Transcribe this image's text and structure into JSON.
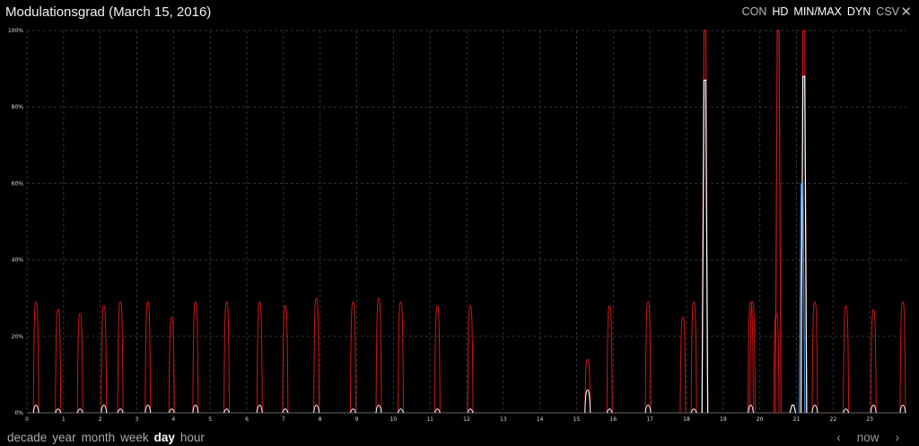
{
  "header": {
    "title": "Modulationsgrad (March 15, 2016)",
    "options": [
      {
        "label": "CON",
        "active": false
      },
      {
        "label": "HD",
        "active": true
      },
      {
        "label": "MIN/MAX",
        "active": true
      },
      {
        "label": "DYN",
        "active": true
      },
      {
        "label": "CSV",
        "active": false
      }
    ],
    "close_glyph": "✕"
  },
  "footer": {
    "ranges": [
      "decade",
      "year",
      "month",
      "week",
      "day",
      "hour"
    ],
    "active_range": "day",
    "prev_glyph": "‹",
    "now_label": "now",
    "next_glyph": "›"
  },
  "colors": {
    "max": "#d01515",
    "value": "#ffffff",
    "min": "#3d8de0",
    "grid": "#333333"
  },
  "chart_data": {
    "type": "line",
    "title": "Modulationsgrad (March 15, 2016)",
    "xlim": [
      0,
      24
    ],
    "ylim": [
      0,
      100
    ],
    "x_ticks": [
      0,
      1,
      2,
      3,
      4,
      5,
      6,
      7,
      8,
      9,
      10,
      11,
      12,
      13,
      14,
      15,
      16,
      17,
      18,
      19,
      20,
      21,
      22,
      23
    ],
    "y_ticks": [
      "0%",
      "20%",
      "40%",
      "60%",
      "80%",
      "100%"
    ],
    "grid": true,
    "series": [
      {
        "key": "max",
        "peaks": [
          {
            "x": 0.25,
            "y": 29
          },
          {
            "x": 0.85,
            "y": 27
          },
          {
            "x": 1.45,
            "y": 26
          },
          {
            "x": 2.1,
            "y": 28
          },
          {
            "x": 2.55,
            "y": 29
          },
          {
            "x": 3.3,
            "y": 29
          },
          {
            "x": 3.95,
            "y": 25
          },
          {
            "x": 4.6,
            "y": 29
          },
          {
            "x": 5.45,
            "y": 29
          },
          {
            "x": 6.35,
            "y": 29
          },
          {
            "x": 7.05,
            "y": 28
          },
          {
            "x": 7.9,
            "y": 30
          },
          {
            "x": 8.9,
            "y": 29
          },
          {
            "x": 9.6,
            "y": 30
          },
          {
            "x": 10.2,
            "y": 29
          },
          {
            "x": 11.2,
            "y": 28
          },
          {
            "x": 12.1,
            "y": 28
          },
          {
            "x": 15.9,
            "y": 28
          },
          {
            "x": 16.95,
            "y": 29
          },
          {
            "x": 18.2,
            "y": 29
          },
          {
            "x": 19.75,
            "y": 29
          },
          {
            "x": 20.45,
            "y": 26
          },
          {
            "x": 21.5,
            "y": 29
          },
          {
            "x": 22.35,
            "y": 28
          },
          {
            "x": 23.1,
            "y": 27
          },
          {
            "x": 23.9,
            "y": 29
          },
          {
            "x": 15.3,
            "y": 14
          },
          {
            "x": 17.9,
            "y": 25
          },
          {
            "x": 19.8,
            "y": 29
          }
        ],
        "spikes": [
          {
            "x": 18.5,
            "y": 100
          },
          {
            "x": 20.5,
            "y": 100
          },
          {
            "x": 21.2,
            "y": 100
          }
        ]
      },
      {
        "key": "value",
        "peaks": [
          {
            "x": 0.25,
            "y": 2
          },
          {
            "x": 0.85,
            "y": 1
          },
          {
            "x": 1.45,
            "y": 1
          },
          {
            "x": 2.1,
            "y": 2
          },
          {
            "x": 2.55,
            "y": 1
          },
          {
            "x": 3.3,
            "y": 2
          },
          {
            "x": 3.95,
            "y": 1
          },
          {
            "x": 4.6,
            "y": 2
          },
          {
            "x": 5.45,
            "y": 1
          },
          {
            "x": 6.35,
            "y": 2
          },
          {
            "x": 7.05,
            "y": 1
          },
          {
            "x": 7.9,
            "y": 2
          },
          {
            "x": 8.9,
            "y": 1
          },
          {
            "x": 9.6,
            "y": 2
          },
          {
            "x": 10.2,
            "y": 1
          },
          {
            "x": 11.2,
            "y": 1
          },
          {
            "x": 12.1,
            "y": 1
          },
          {
            "x": 15.3,
            "y": 6
          },
          {
            "x": 15.9,
            "y": 1
          },
          {
            "x": 16.95,
            "y": 2
          },
          {
            "x": 18.2,
            "y": 1
          },
          {
            "x": 19.75,
            "y": 2
          },
          {
            "x": 21.5,
            "y": 2
          },
          {
            "x": 22.35,
            "y": 1
          },
          {
            "x": 23.1,
            "y": 2
          },
          {
            "x": 23.9,
            "y": 2
          }
        ],
        "spikes": [
          {
            "x": 18.5,
            "y": 87
          },
          {
            "x": 21.2,
            "y": 88
          },
          {
            "x": 20.9,
            "y": 2
          }
        ]
      },
      {
        "key": "min",
        "spikes": [
          {
            "x": 21.15,
            "y": 60
          }
        ]
      }
    ]
  }
}
